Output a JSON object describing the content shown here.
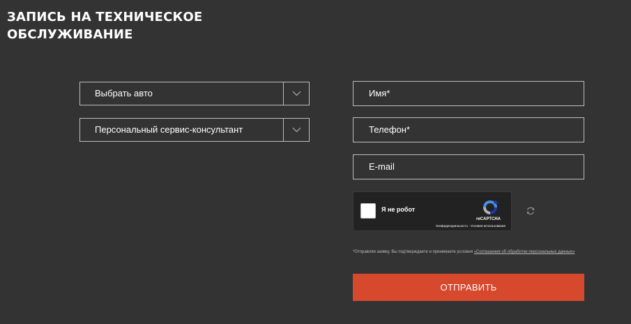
{
  "page": {
    "title_line1": "ЗАПИСЬ НА ТЕХНИЧЕСКОЕ",
    "title_line2": "ОБСЛУЖИВАНИЕ"
  },
  "form": {
    "left": {
      "car_select": {
        "label": "Выбрать авто",
        "icon": "chevron-down-icon"
      },
      "consultant_select": {
        "label": "Персональный сервис-консультант",
        "icon": "chevron-down-icon"
      }
    },
    "right": {
      "name_field": {
        "placeholder": "Имя*"
      },
      "phone_field": {
        "placeholder": "Телефон*"
      },
      "email_field": {
        "placeholder": "E-mail"
      }
    },
    "recaptcha": {
      "label": "Я не робот",
      "brand": "reCAPTCHA",
      "links": "Конфиденциальность - Условия использования",
      "refresh_icon": "refresh-icon"
    },
    "consent": {
      "text": "*Отправляя заявку, Вы подтверждаете и принимаете условия ",
      "link_text": "«Соглашения об обработке персональных данных»"
    },
    "submit_label": "ОТПРАВИТЬ"
  },
  "colors": {
    "background": "#333333",
    "accent": "#d6492c",
    "border": "#bdbdbd",
    "text": "#ffffff"
  }
}
